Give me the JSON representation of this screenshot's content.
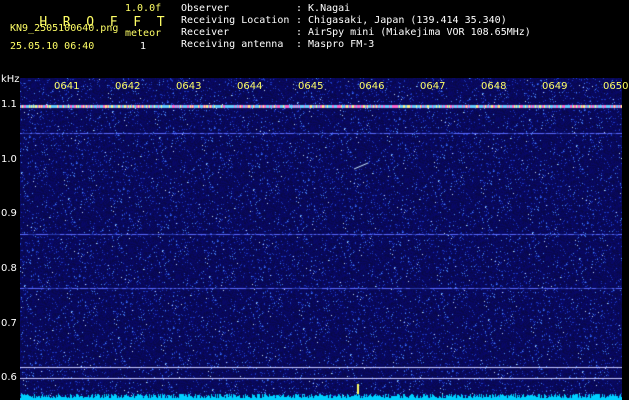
{
  "header": {
    "title_letters": [
      "H",
      "R",
      "O",
      "F",
      "F",
      "T"
    ],
    "version": "1.0.0f",
    "filename": "KN9_2505100640.png",
    "datetime": "25.05.10 06:40",
    "meteor_label": "meteor",
    "meteor_count": "1",
    "info": [
      {
        "label": "Observer",
        "value": ": K.Nagai"
      },
      {
        "label": "Receiving Location",
        "value": ": Chigasaki, Japan (139.414 35.340)"
      },
      {
        "label": "Receiver",
        "value": ": AirSpy mini (Miakejima VOR 108.65MHz)"
      },
      {
        "label": "Receiving antenna",
        "value": ": Maspro FM-3"
      }
    ]
  },
  "colors": {
    "background": "#000000",
    "spectrogram_base": "#0a0a5a",
    "header_yellow": "#ffff66",
    "header_white": "#ffffff",
    "signal": "#00e0ff"
  },
  "chart_data": {
    "type": "heatmap",
    "ylabel": "kHz",
    "x_ticks": [
      "0641",
      "0642",
      "0643",
      "0644",
      "0645",
      "0646",
      "0647",
      "0648",
      "0649",
      "0650"
    ],
    "y_ticks": [
      "1.1",
      "1.0",
      "0.9",
      "0.8",
      "0.7",
      "0.6"
    ],
    "ylim": [
      0.56,
      1.15
    ],
    "features": [
      {
        "name": "carrier",
        "freq_khz": 1.098
      },
      {
        "name": "horizontal line",
        "freq_khz": 1.05
      },
      {
        "name": "horizontal line",
        "freq_khz": 0.865
      },
      {
        "name": "horizontal line",
        "freq_khz": 0.765
      },
      {
        "name": "horizontal line",
        "freq_khz": 0.62
      },
      {
        "name": "horizontal line",
        "freq_khz": 0.6
      }
    ],
    "meteor_echo": {
      "time": "0646",
      "freq_khz": 0.99
    }
  }
}
